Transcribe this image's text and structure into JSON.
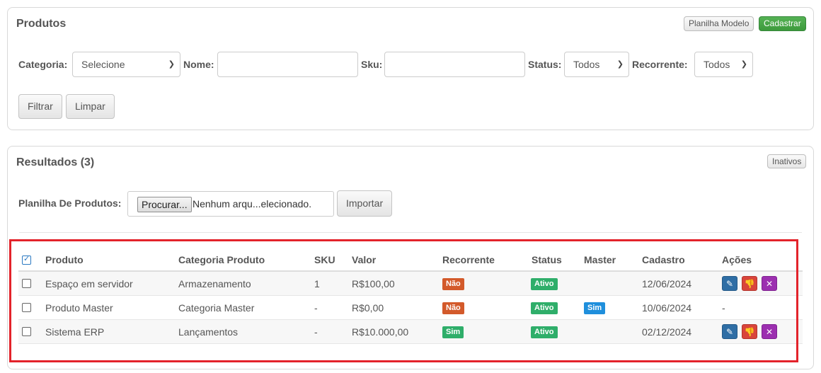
{
  "filter_panel": {
    "title": "Produtos",
    "template_button": "Planilha Modelo",
    "register_button": "Cadastrar",
    "category_label": "Categoria:",
    "category_value": "Selecione",
    "name_label": "Nome:",
    "name_value": "",
    "sku_label": "Sku:",
    "sku_value": "",
    "status_label": "Status:",
    "status_value": "Todos",
    "recurrent_label": "Recorrente:",
    "recurrent_value": "Todos",
    "filter_button": "Filtrar",
    "clear_button": "Limpar"
  },
  "results_panel": {
    "title": "Resultados (3)",
    "inactive_button": "Inativos",
    "import_label": "Planilha De Produtos:",
    "browse_button": "Procurar...",
    "file_text": "Nenhum arqu...elecionado.",
    "import_button": "Importar"
  },
  "table": {
    "headers": [
      "Produto",
      "Categoria Produto",
      "SKU",
      "Valor",
      "Recorrente",
      "Status",
      "Master",
      "Cadastro",
      "Ações"
    ],
    "rows": [
      {
        "produto": "Espaço em servidor",
        "categoria": "Armazenamento",
        "sku": "1",
        "valor": "R$100,00",
        "recorrente": "Não",
        "status": "Ativo",
        "master": "",
        "cadastro": "12/06/2024",
        "acoes": ""
      },
      {
        "produto": "Produto Master",
        "categoria": "Categoria Master",
        "sku": "-",
        "valor": "R$0,00",
        "recorrente": "Não",
        "status": "Ativo",
        "master": "Sim",
        "cadastro": "10/06/2024",
        "acoes": "-"
      },
      {
        "produto": "Sistema ERP",
        "categoria": "Lançamentos",
        "sku": "-",
        "valor": "R$10.000,00",
        "recorrente": "Sim",
        "status": "Ativo",
        "master": "",
        "cadastro": "02/12/2024",
        "acoes": ""
      }
    ]
  },
  "icons": {
    "dropdown": "chevron-down-icon",
    "edit": "edit-icon",
    "disable": "thumbs-down-icon",
    "delete": "close-icon",
    "edit_glyph": "✎",
    "disable_glyph": "👎",
    "delete_glyph": "✕"
  },
  "colors": {
    "green_button": "#3d9a3c",
    "highlight_border": "#e3232b",
    "badge_nao": "#d35a2b",
    "badge_sim": "#2fae6a",
    "badge_master": "#1f8fdc"
  }
}
